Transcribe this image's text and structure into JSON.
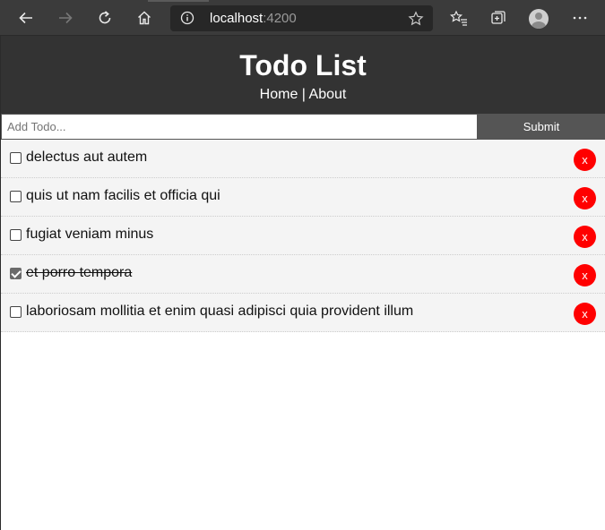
{
  "browser": {
    "url_host": "localhost",
    "url_port": ":4200"
  },
  "app": {
    "title": "Todo List",
    "nav": {
      "home": "Home",
      "separator": " | ",
      "about": "About"
    }
  },
  "form": {
    "placeholder": "Add Todo...",
    "value": "",
    "submit_label": "Submit"
  },
  "todos": [
    {
      "title": "delectus aut autem",
      "completed": false,
      "delete_label": "x"
    },
    {
      "title": "quis ut nam facilis et officia qui",
      "completed": false,
      "delete_label": "x"
    },
    {
      "title": "fugiat veniam minus",
      "completed": false,
      "delete_label": "x"
    },
    {
      "title": "et porro tempora",
      "completed": true,
      "delete_label": "x"
    },
    {
      "title": "laboriosam mollitia et enim quasi adipisci quia provident illum",
      "completed": false,
      "delete_label": "x"
    }
  ],
  "colors": {
    "header_bg": "#333333",
    "item_bg": "#f4f4f4",
    "delete_button": "#ff0000",
    "submit_button": "#555555"
  },
  "icons": {
    "back": "back-arrow-icon",
    "forward": "forward-arrow-icon",
    "refresh": "refresh-icon",
    "home": "home-icon",
    "site_info": "info-icon",
    "favorite": "star-icon",
    "favorites": "favorites-icon",
    "collections": "collections-icon",
    "profile": "profile-avatar-icon",
    "more": "more-icon"
  }
}
